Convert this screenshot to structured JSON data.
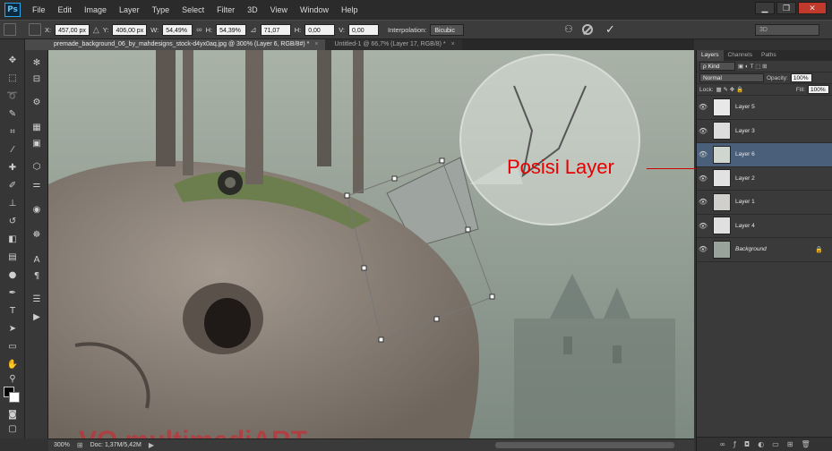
{
  "app": {
    "logo": "Ps"
  },
  "menu": [
    "File",
    "Edit",
    "Image",
    "Layer",
    "Type",
    "Select",
    "Filter",
    "3D",
    "View",
    "Window",
    "Help"
  ],
  "window_buttons": {
    "minimize": "▁",
    "restore": "❐",
    "close": "✕"
  },
  "options": {
    "x_label": "X:",
    "x_value": "457,00 px",
    "y_label": "Y:",
    "y_value": "406,00 px",
    "w_label": "W:",
    "w_value": "54,49%",
    "h_label": "H:",
    "h_value": "54,39%",
    "angle_value": "71,07",
    "hskew_label": "H:",
    "hskew_value": "0,00",
    "vskew_label": "V:",
    "vskew_value": "0,00",
    "interp_label": "Interpolation:",
    "interp_value": "Bicubic",
    "workspace": "3D"
  },
  "tabs": [
    {
      "label": "premade_background_06_by_mahdesigns_stock-d4yx0aq.jpg @ 300% (Layer 6, RGB/8#) *",
      "close": "×"
    },
    {
      "label": "Untitled-1 @ 66,7% (Layer 17, RGB/8) *",
      "close": "×"
    }
  ],
  "canvas": {
    "annotation": "Posisi Layer",
    "watermark": "VO multimediART"
  },
  "status": {
    "zoom": "300%",
    "doc": "Doc: 1,37M/5,42M"
  },
  "panel": {
    "tabs": [
      "Layers",
      "Channels",
      "Paths"
    ],
    "kind": "ρ Kind",
    "blend": "Normal",
    "opacity_label": "Opacity:",
    "opacity": "100%",
    "lock_label": "Lock:",
    "fill_label": "Fill:",
    "fill": "100%",
    "layers": [
      {
        "name": "Layer 5"
      },
      {
        "name": "Layer 3"
      },
      {
        "name": "Layer 6"
      },
      {
        "name": "Layer 2"
      },
      {
        "name": "Layer 1"
      },
      {
        "name": "Layer 4"
      },
      {
        "name": "Background"
      }
    ],
    "selected": "Layer 6"
  },
  "colors": {
    "accent": "#4a5f7a",
    "annotation": "#e60000"
  }
}
